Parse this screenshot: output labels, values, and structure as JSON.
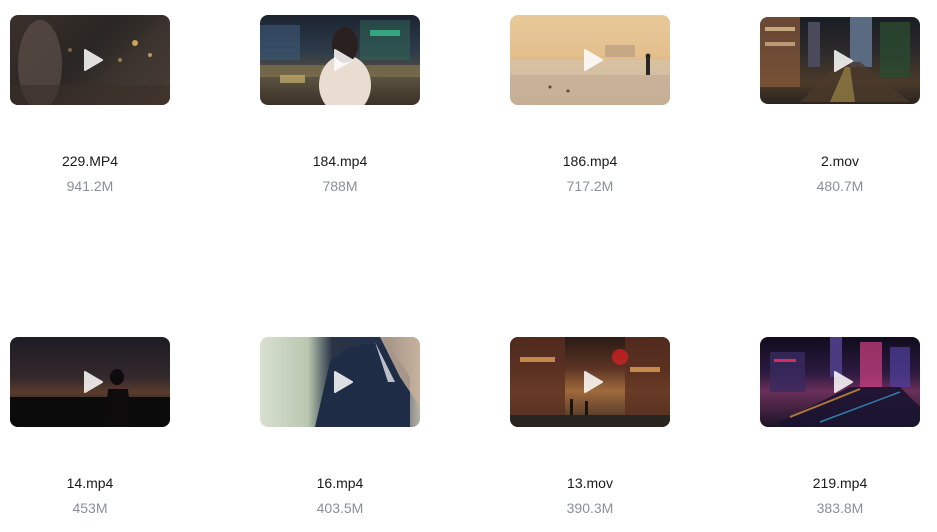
{
  "videos": [
    {
      "name": "229.MP4",
      "size": "941.2M",
      "scene": "night street blur",
      "icon": "play-icon"
    },
    {
      "name": "184.mp4",
      "size": "788M",
      "scene": "woman facing city traffic at night",
      "icon": "play-icon"
    },
    {
      "name": "186.mp4",
      "size": "717.2M",
      "scene": "beach at sunset with walker",
      "icon": "play-icon"
    },
    {
      "name": "2.mov",
      "size": "480.7M",
      "scene": "city street at night with buildings",
      "icon": "play-icon"
    },
    {
      "name": "14.mp4",
      "size": "453M",
      "scene": "silhouette at dusk",
      "icon": "play-icon"
    },
    {
      "name": "16.mp4",
      "size": "403.5M",
      "scene": "man in suit close-up",
      "icon": "play-icon"
    },
    {
      "name": "13.mov",
      "size": "390.3M",
      "scene": "old town street with lanterns",
      "icon": "play-icon"
    },
    {
      "name": "219.mp4",
      "size": "383.8M",
      "scene": "aerial neon city at night",
      "icon": "play-icon"
    }
  ]
}
